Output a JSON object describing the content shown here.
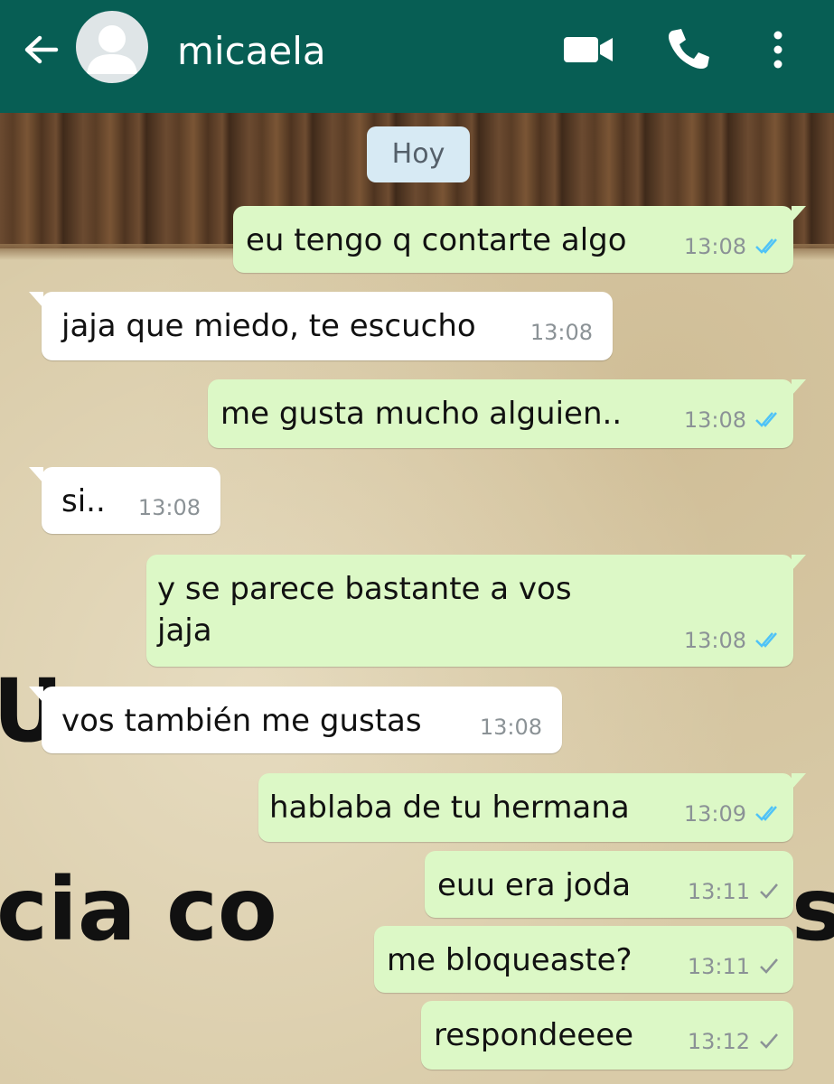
{
  "header": {
    "contact_name": "micaela",
    "icons": [
      "back-arrow-icon",
      "avatar",
      "video-call-icon",
      "phone-icon",
      "more-options-icon"
    ]
  },
  "wallpaper": {
    "text_line_1": "Un v",
    "text_line_2": "cia co",
    "text_line_3": "s"
  },
  "date_chip": "Hoy",
  "colors": {
    "header": "#075e54",
    "outgoing_bubble": "#dcf8c6",
    "incoming_bubble": "#ffffff",
    "read_ticks": "#4fc3f7",
    "sent_tick": "#8b9296"
  },
  "messages": [
    {
      "direction": "out",
      "text": "eu tengo q contarte algo",
      "time": "13:08",
      "status": "read"
    },
    {
      "direction": "in",
      "text": "jaja que miedo, te escucho",
      "time": "13:08"
    },
    {
      "direction": "out",
      "text": "me gusta mucho alguien..",
      "time": "13:08",
      "status": "read"
    },
    {
      "direction": "in",
      "text": "si..",
      "time": "13:08"
    },
    {
      "direction": "out",
      "text": "y se parece bastante a vos",
      "text_line2": "jaja",
      "time": "13:08",
      "status": "read"
    },
    {
      "direction": "in",
      "text": "vos también me gustas",
      "time": "13:08"
    },
    {
      "direction": "out",
      "text": "hablaba de tu hermana",
      "time": "13:09",
      "status": "read"
    },
    {
      "direction": "out",
      "text": "euu era joda",
      "time": "13:11",
      "status": "sent"
    },
    {
      "direction": "out",
      "text": "me bloqueaste?",
      "time": "13:11",
      "status": "sent"
    },
    {
      "direction": "out",
      "text": "respondeeee",
      "time": "13:12",
      "status": "sent"
    }
  ]
}
